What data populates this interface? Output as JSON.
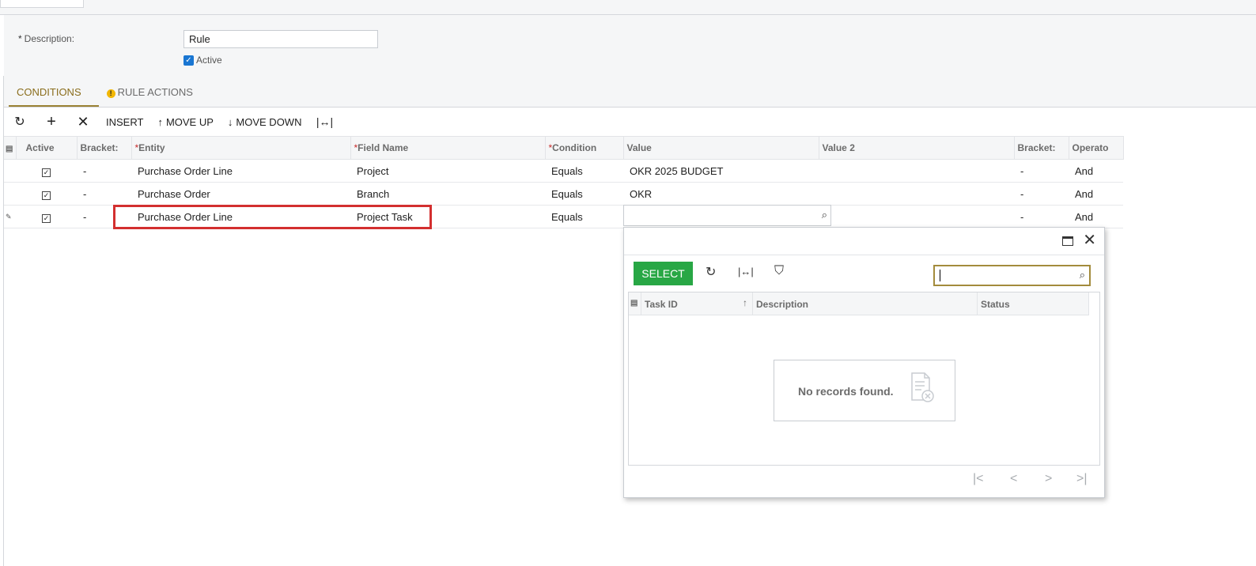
{
  "header": {
    "description_label": "Description:",
    "description_required_mark": "*",
    "description_value": "Rule",
    "active_label": "Active",
    "active_checked": true
  },
  "tabs": [
    {
      "label": "CONDITIONS",
      "active": true
    },
    {
      "label": "RULE ACTIONS",
      "active": false,
      "warning": true
    }
  ],
  "toolbar": {
    "refresh_icon": "refresh-icon",
    "add_icon": "plus-icon",
    "delete_icon": "x-icon",
    "insert_label": "INSERT",
    "move_up_label": "MOVE UP",
    "move_down_label": "MOVE DOWN",
    "fit_icon": "fit-columns-icon"
  },
  "grid": {
    "columns": [
      "Active",
      "Bracket:",
      "Entity",
      "Field Name",
      "Condition",
      "Value",
      "Value 2",
      "Bracket:",
      "Operato"
    ],
    "required_mark": "*",
    "rows": [
      {
        "active": true,
        "bracket_open": "-",
        "entity": "Purchase Order Line",
        "field_name": "Project",
        "condition": "Equals",
        "value": "OKR 2025 BUDGET",
        "value2": "",
        "bracket_close": "-",
        "operator": "And"
      },
      {
        "active": true,
        "bracket_open": "-",
        "entity": "Purchase Order",
        "field_name": "Branch",
        "condition": "Equals",
        "value": "OKR",
        "value2": "",
        "bracket_close": "-",
        "operator": "And"
      },
      {
        "active": true,
        "bracket_open": "-",
        "entity": "Purchase Order Line",
        "field_name": "Project Task",
        "condition": "Equals",
        "value": "",
        "value2": "",
        "bracket_close": "-",
        "operator": "And",
        "editing": true
      }
    ]
  },
  "lookup_popup": {
    "select_label": "SELECT",
    "search_value": "",
    "columns": [
      "Task ID",
      "Description",
      "Status"
    ],
    "sort_indicator": "↑",
    "empty_message": "No records found.",
    "accent": "#28a745"
  }
}
